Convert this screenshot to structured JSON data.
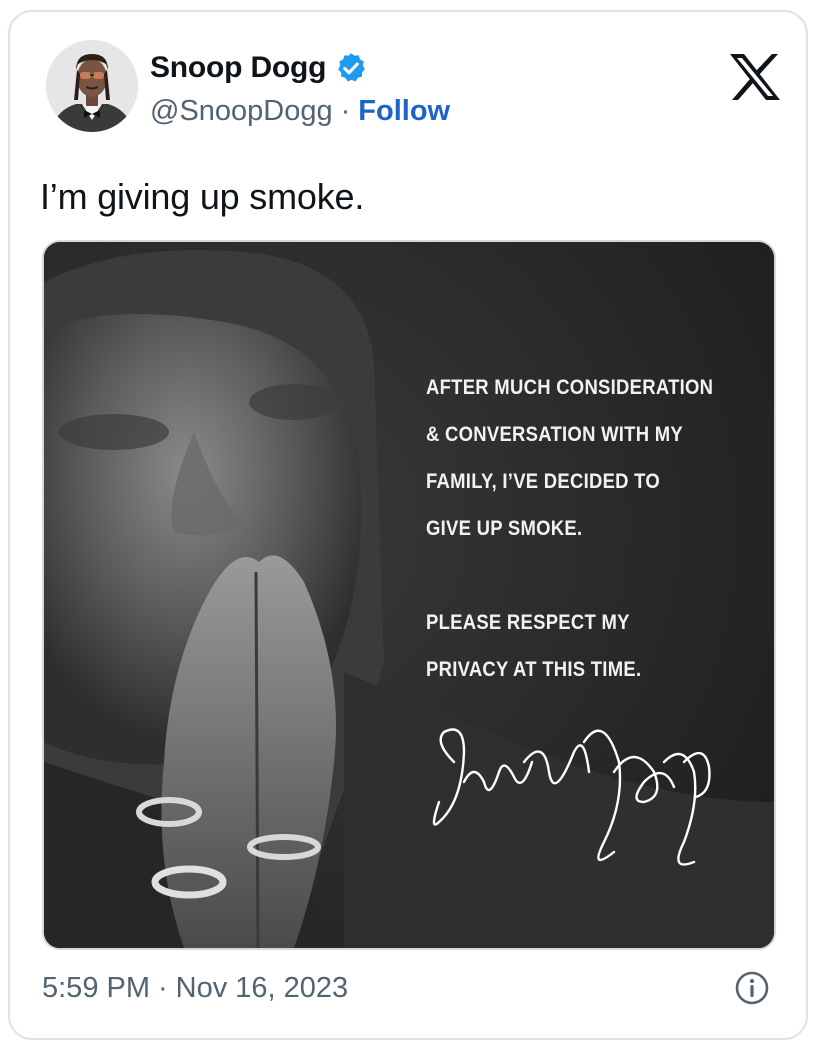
{
  "author": {
    "display_name": "Snoop Dogg",
    "handle": "@SnoopDogg",
    "separator": "·",
    "follow_label": "Follow",
    "verified_icon": "verified-badge-icon",
    "avatar": "profile-photo"
  },
  "platform_logo": "x-logo-icon",
  "tweet": {
    "text": "I’m giving up smoke."
  },
  "media": {
    "statement_lines": [
      "AFTER MUCH CONSIDERATION",
      "& CONVERSATION WITH MY",
      "FAMILY, I’VE DECIDED TO",
      "GIVE UP SMOKE.",
      "PLEASE RESPECT MY",
      "PRIVACY AT THIS TIME."
    ],
    "signature": "Snoop Dogg"
  },
  "footer": {
    "time": "5:59 PM",
    "separator": "·",
    "date": "Nov 16, 2023",
    "info_icon": "info-icon"
  },
  "colors": {
    "text_primary": "#0f1419",
    "text_secondary": "#536471",
    "link": "#1d63c9",
    "verified": "#1d9bf0",
    "border": "#dfe3e8"
  }
}
